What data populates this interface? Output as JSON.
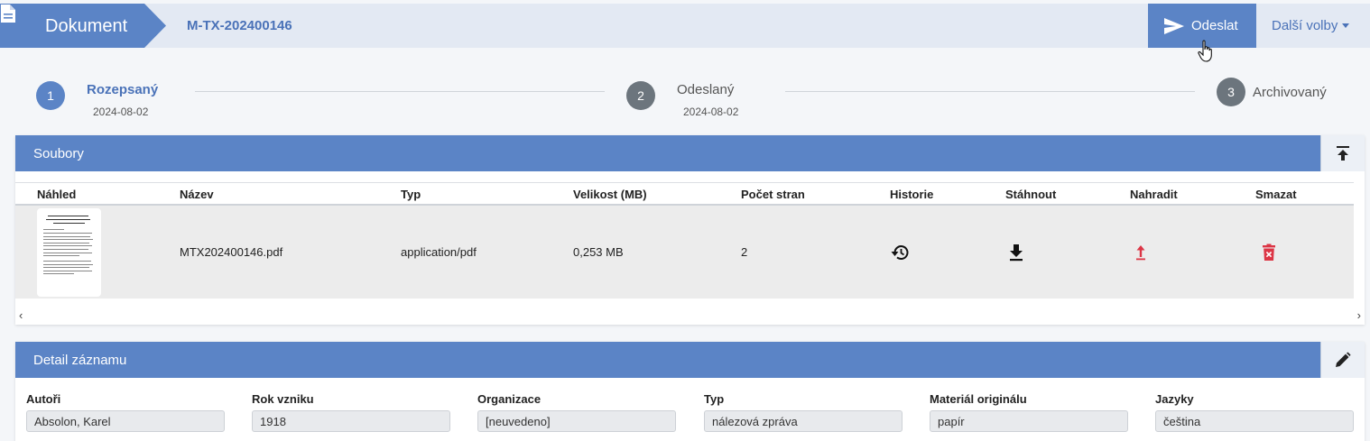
{
  "header": {
    "doc_label": "Dokument",
    "doc_id": "M-TX-202400146",
    "send_label": "Odeslat",
    "more_label": "Další volby"
  },
  "steps": [
    {
      "num": "1",
      "label": "Rozepsaný",
      "date": "2024-08-02",
      "active": true
    },
    {
      "num": "2",
      "label": "Odeslaný",
      "date": "2024-08-02",
      "active": false
    },
    {
      "num": "3",
      "label": "Archivovaný",
      "date": "",
      "active": false
    }
  ],
  "files": {
    "title": "Soubory",
    "columns": [
      "Náhled",
      "Název",
      "Typ",
      "Velikost (MB)",
      "Počet stran",
      "Historie",
      "Stáhnout",
      "Nahradit",
      "Smazat"
    ],
    "rows": [
      {
        "name": "MTX202400146.pdf",
        "type": "application/pdf",
        "size": "0,253 MB",
        "pages": "2"
      }
    ],
    "scroll_left": "‹",
    "scroll_right": "›"
  },
  "detail": {
    "title": "Detail záznamu",
    "fields": [
      {
        "label": "Autoři",
        "value": "Absolon, Karel"
      },
      {
        "label": "Rok vzniku",
        "value": "1918"
      },
      {
        "label": "Organizace",
        "value": "[neuvedeno]"
      },
      {
        "label": "Typ",
        "value": "nálezová zpráva"
      },
      {
        "label": "Materiál originálu",
        "value": "papír"
      },
      {
        "label": "Jazyky",
        "value": "čeština"
      }
    ]
  },
  "colors": {
    "primary": "#5b84c6",
    "primary_text": "#4a72b8",
    "step_inactive": "#6c757d",
    "danger": "#dc3545"
  },
  "icons": {
    "document": "document-icon",
    "send": "send-icon",
    "collapse": "collapse-top-icon",
    "history": "history-icon",
    "download": "download-icon",
    "replace": "upload-arrow-icon",
    "delete": "trash-icon",
    "edit": "pencil-icon"
  }
}
